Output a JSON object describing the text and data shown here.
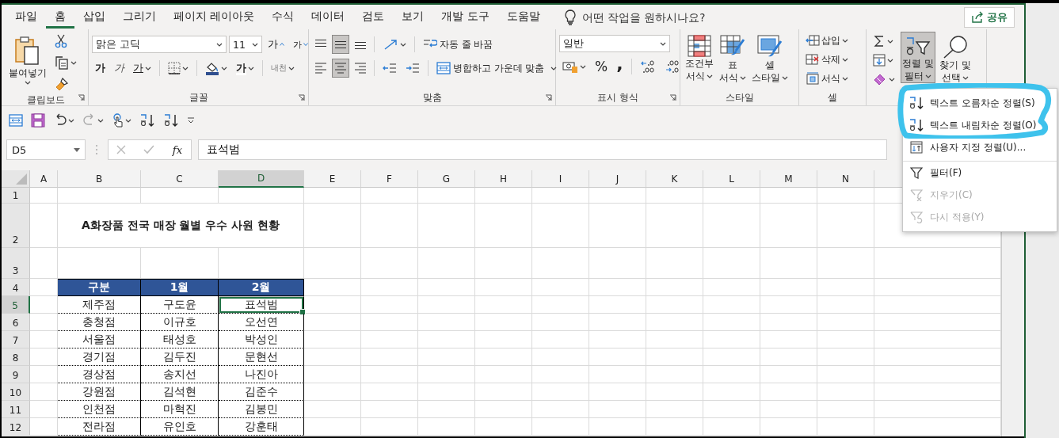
{
  "ribbon_tabs": [
    {
      "label": "파일",
      "selected": false
    },
    {
      "label": "홈",
      "selected": true
    },
    {
      "label": "삽입",
      "selected": false
    },
    {
      "label": "그리기",
      "selected": false
    },
    {
      "label": "페이지 레이아웃",
      "selected": false
    },
    {
      "label": "수식",
      "selected": false
    },
    {
      "label": "데이터",
      "selected": false
    },
    {
      "label": "검토",
      "selected": false
    },
    {
      "label": "보기",
      "selected": false
    },
    {
      "label": "개발 도구",
      "selected": false
    },
    {
      "label": "도움말",
      "selected": false
    }
  ],
  "tell_me": {
    "placeholder": "어떤 작업을 원하시나요?"
  },
  "share_button": "공유",
  "clipboard": {
    "paste": "붙여넣기",
    "label": "클립보드"
  },
  "font": {
    "name": "맑은 고딕",
    "size": "11",
    "grow": "가",
    "shrink": "가",
    "bold": "가",
    "italic": "가",
    "underline": "가",
    "font_color": "가",
    "phonetic": "내천",
    "label": "글꼴"
  },
  "alignment": {
    "vertical": [
      {
        "kind": "top",
        "selected": false
      },
      {
        "kind": "middle",
        "selected": true
      },
      {
        "kind": "bottom",
        "selected": false
      }
    ],
    "horizontal": [
      {
        "kind": "left",
        "selected": false
      },
      {
        "kind": "center",
        "selected": true
      },
      {
        "kind": "right",
        "selected": false
      }
    ],
    "wrap_text": "자동 줄 바꿈",
    "merge_center": "병합하고 가운데 맞춤",
    "label": "맞춤"
  },
  "number": {
    "format": "일반",
    "percent": "%",
    "comma": ",",
    "label": "표시 형식"
  },
  "styles": {
    "buttons": [
      {
        "kind": "conditional",
        "line1": "조건부",
        "line2": "서식"
      },
      {
        "kind": "table",
        "line1": "표",
        "line2": "서식"
      },
      {
        "kind": "cell",
        "line1": "셀",
        "line2": "스타일"
      }
    ],
    "label": "스타일"
  },
  "cells": {
    "buttons": [
      {
        "kind": "insert",
        "label": "삽입"
      },
      {
        "kind": "delete",
        "label": "삭제"
      },
      {
        "kind": "format",
        "label": "서식"
      }
    ],
    "label": "셀"
  },
  "editing": {
    "sort_filter": {
      "line1": "정렬 및",
      "line2": "필터",
      "pressed": true
    },
    "find_select": {
      "line1": "찾기 및",
      "line2": "선택"
    }
  },
  "formula_bar": {
    "name_box": "D5",
    "function_label": "fx",
    "value": "표석범"
  },
  "columns": [
    {
      "label": "A",
      "selected": false
    },
    {
      "label": "B",
      "selected": false
    },
    {
      "label": "C",
      "selected": false
    },
    {
      "label": "D",
      "selected": true
    },
    {
      "label": "E",
      "selected": false
    },
    {
      "label": "F",
      "selected": false
    },
    {
      "label": "G",
      "selected": false
    },
    {
      "label": "H",
      "selected": false
    },
    {
      "label": "I",
      "selected": false
    },
    {
      "label": "J",
      "selected": false
    },
    {
      "label": "K",
      "selected": false
    },
    {
      "label": "L",
      "selected": false
    },
    {
      "label": "M",
      "selected": false
    },
    {
      "label": "N",
      "selected": false
    }
  ],
  "rows": [
    {
      "number": "1",
      "kind": "blank",
      "selected": false
    },
    {
      "number": "2",
      "kind": "title",
      "selected": false
    },
    {
      "number": "3",
      "kind": "tall",
      "selected": false
    },
    {
      "number": "4",
      "kind": "header",
      "selected": false
    },
    {
      "number": "5",
      "kind": "data",
      "selected": true
    },
    {
      "number": "6",
      "kind": "data",
      "selected": false
    },
    {
      "number": "7",
      "kind": "data",
      "selected": false
    },
    {
      "number": "8",
      "kind": "data",
      "selected": false
    },
    {
      "number": "9",
      "kind": "data",
      "selected": false
    },
    {
      "number": "10",
      "kind": "data",
      "selected": false
    },
    {
      "number": "11",
      "kind": "data",
      "selected": false
    },
    {
      "number": "12",
      "kind": "data",
      "selected": false
    }
  ],
  "title": "A화장품 전국 매장 월별 우수 사원 현황",
  "table": {
    "header": [
      "구분",
      "1월",
      "2월"
    ],
    "rows": [
      {
        "cells": [
          {
            "text": "제주점",
            "selected": false
          },
          {
            "text": "구도윤",
            "selected": false
          },
          {
            "text": "표석범",
            "selected": true
          }
        ]
      },
      {
        "cells": [
          {
            "text": "충청점",
            "selected": false
          },
          {
            "text": "이규호",
            "selected": false
          },
          {
            "text": "오선연",
            "selected": false
          }
        ]
      },
      {
        "cells": [
          {
            "text": "서울점",
            "selected": false
          },
          {
            "text": "태성호",
            "selected": false
          },
          {
            "text": "박성인",
            "selected": false
          }
        ]
      },
      {
        "cells": [
          {
            "text": "경기점",
            "selected": false
          },
          {
            "text": "김두진",
            "selected": false
          },
          {
            "text": "문현선",
            "selected": false
          }
        ]
      },
      {
        "cells": [
          {
            "text": "경상점",
            "selected": false
          },
          {
            "text": "송지선",
            "selected": false
          },
          {
            "text": "나진아",
            "selected": false
          }
        ]
      },
      {
        "cells": [
          {
            "text": "강원점",
            "selected": false
          },
          {
            "text": "김석현",
            "selected": false
          },
          {
            "text": "김준수",
            "selected": false
          }
        ]
      },
      {
        "cells": [
          {
            "text": "인천점",
            "selected": false
          },
          {
            "text": "마혁진",
            "selected": false
          },
          {
            "text": "김봉민",
            "selected": false
          }
        ]
      },
      {
        "cells": [
          {
            "text": "전라점",
            "selected": false
          },
          {
            "text": "유인호",
            "selected": false
          },
          {
            "text": "강훈태",
            "selected": false
          }
        ]
      }
    ]
  },
  "sort_menu": [
    {
      "kind": "sort_asc",
      "label": "텍스트 오름차순 정렬(S)",
      "disabled": false,
      "separator_before": false
    },
    {
      "kind": "sort_desc",
      "label": "텍스트 내림차순 정렬(O)",
      "disabled": false,
      "separator_before": false
    },
    {
      "kind": "custom_sort",
      "label": "사용자 지정 정렬(U)...",
      "disabled": false,
      "separator_before": false
    },
    {
      "kind": "filter",
      "label": "필터(F)",
      "disabled": false,
      "separator_before": true
    },
    {
      "kind": "clear",
      "label": "지우기(C)",
      "disabled": true,
      "separator_before": false
    },
    {
      "kind": "reapply",
      "label": "다시 적용(Y)",
      "disabled": true,
      "separator_before": false
    }
  ]
}
